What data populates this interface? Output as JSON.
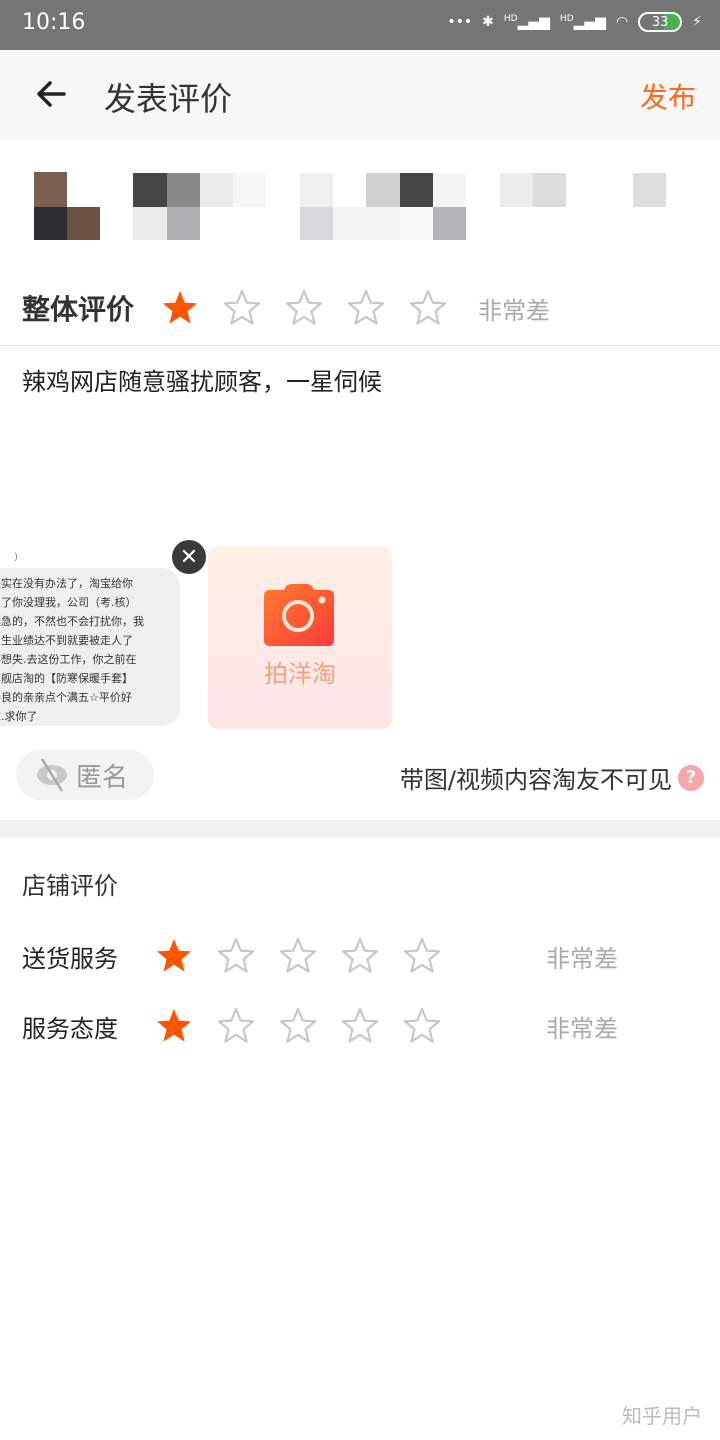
{
  "status_bar": {
    "time": "10:16",
    "signal_labels": [
      "HD",
      "HD"
    ],
    "battery": "33",
    "icons": [
      "more-dots-icon",
      "bluetooth-icon",
      "signal-icon",
      "signal-icon",
      "wifi-icon",
      "battery-icon",
      "charging-icon"
    ]
  },
  "header": {
    "title": "发表评价",
    "publish_label": "发布"
  },
  "overall": {
    "label": "整体评价",
    "rating": 1,
    "max": 5,
    "rating_text": "非常差"
  },
  "review": {
    "text": "辣鸡网店随意骚扰顾客，一星伺候"
  },
  "attached_image": {
    "lines": [
      "是实在没有办法了，淘宝给你",
      "息了你没理我，公司（考.核）",
      "挺急的，不然也不会打扰你，我",
      "习生业绩达不到就要被走人了",
      "不想失.去这份工作，你之前在",
      "旗舰店淘的【防寒保暖手套】",
      "善良的亲亲点个满五☆平价好",
      "求.求你了"
    ]
  },
  "add_photo": {
    "label": "拍洋淘"
  },
  "anonymous": {
    "label": "匿名"
  },
  "visibility_note": "带图/视频内容淘友不可见",
  "shop_review": {
    "title": "店铺评价",
    "items": [
      {
        "label": "送货服务",
        "rating": 1,
        "max": 5,
        "rating_text": "非常差"
      },
      {
        "label": "服务态度",
        "rating": 1,
        "max": 5,
        "rating_text": "非常差"
      }
    ]
  },
  "colors": {
    "accent": "#ff6a1a",
    "star_filled": "#ff5500",
    "star_empty": "#c8c8cc"
  },
  "watermark": "知乎用户"
}
